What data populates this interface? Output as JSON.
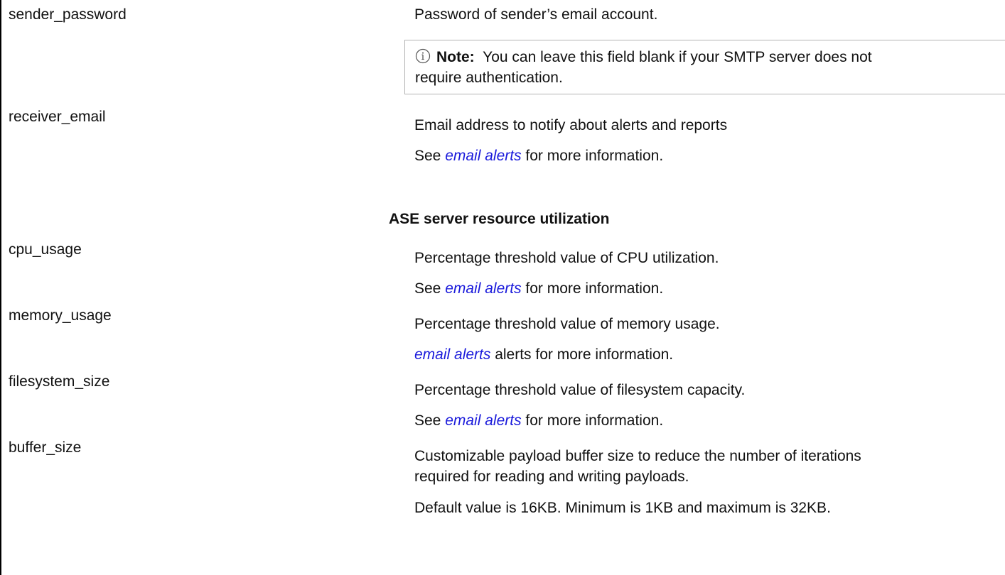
{
  "rows": [
    {
      "param": "sender_password",
      "description": "Password of sender’s email account.",
      "note": {
        "label": "Note:",
        "line1": "You can leave this field blank if your SMTP server does not",
        "line2": "require authentication."
      }
    },
    {
      "param": "receiver_email",
      "description": "Email address to notify about alerts and reports",
      "see_prefix": "See ",
      "link": "email alerts",
      "see_suffix": " for more information."
    },
    {
      "param": "cpu_usage",
      "description": "Percentage threshold value of CPU utilization.",
      "see_prefix": "See ",
      "link": "email alerts",
      "see_suffix": " for more information."
    },
    {
      "param": "memory_usage",
      "description": "Percentage threshold value of memory usage.",
      "link": "email alerts",
      "see_suffix": " alerts for more information."
    },
    {
      "param": "filesystem_size",
      "description": "Percentage threshold value of filesystem capacity.",
      "see_prefix": "See ",
      "link": "email alerts",
      "see_suffix": " for more information."
    },
    {
      "param": "buffer_size",
      "description_line1": "Customizable payload buffer size to reduce the number of iterations",
      "description_line2": "required for reading and writing payloads.",
      "default_text": "Default value is 16KB. Minimum is 1KB and maximum is 32KB."
    }
  ],
  "section_heading": "ASE server resource utilization",
  "icons": {
    "note": "info-circle-icon"
  }
}
